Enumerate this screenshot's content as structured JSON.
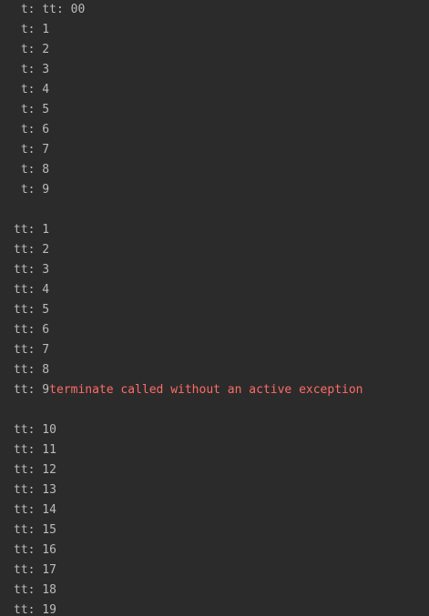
{
  "console": {
    "lines": [
      {
        "text": " t: tt: 00",
        "error": ""
      },
      {
        "text": " t: 1",
        "error": ""
      },
      {
        "text": " t: 2",
        "error": ""
      },
      {
        "text": " t: 3",
        "error": ""
      },
      {
        "text": " t: 4",
        "error": ""
      },
      {
        "text": " t: 5",
        "error": ""
      },
      {
        "text": " t: 6",
        "error": ""
      },
      {
        "text": " t: 7",
        "error": ""
      },
      {
        "text": " t: 8",
        "error": ""
      },
      {
        "text": " t: 9",
        "error": ""
      },
      {
        "text": "",
        "error": ""
      },
      {
        "text": "tt: 1",
        "error": ""
      },
      {
        "text": "tt: 2",
        "error": ""
      },
      {
        "text": "tt: 3",
        "error": ""
      },
      {
        "text": "tt: 4",
        "error": ""
      },
      {
        "text": "tt: 5",
        "error": ""
      },
      {
        "text": "tt: 6",
        "error": ""
      },
      {
        "text": "tt: 7",
        "error": ""
      },
      {
        "text": "tt: 8",
        "error": ""
      },
      {
        "text": "tt: 9",
        "error": "terminate called without an active exception"
      },
      {
        "text": "",
        "error": ""
      },
      {
        "text": "tt: 10",
        "error": ""
      },
      {
        "text": "tt: 11",
        "error": ""
      },
      {
        "text": "tt: 12",
        "error": ""
      },
      {
        "text": "tt: 13",
        "error": ""
      },
      {
        "text": "tt: 14",
        "error": ""
      },
      {
        "text": "tt: 15",
        "error": ""
      },
      {
        "text": "tt: 16",
        "error": ""
      },
      {
        "text": "tt: 17",
        "error": ""
      },
      {
        "text": "tt: 18",
        "error": ""
      },
      {
        "text": "tt: 19",
        "error": ""
      }
    ]
  },
  "colors": {
    "background": "#2b2b2b",
    "text": "#bbbbbb",
    "error": "#ff6b68"
  }
}
